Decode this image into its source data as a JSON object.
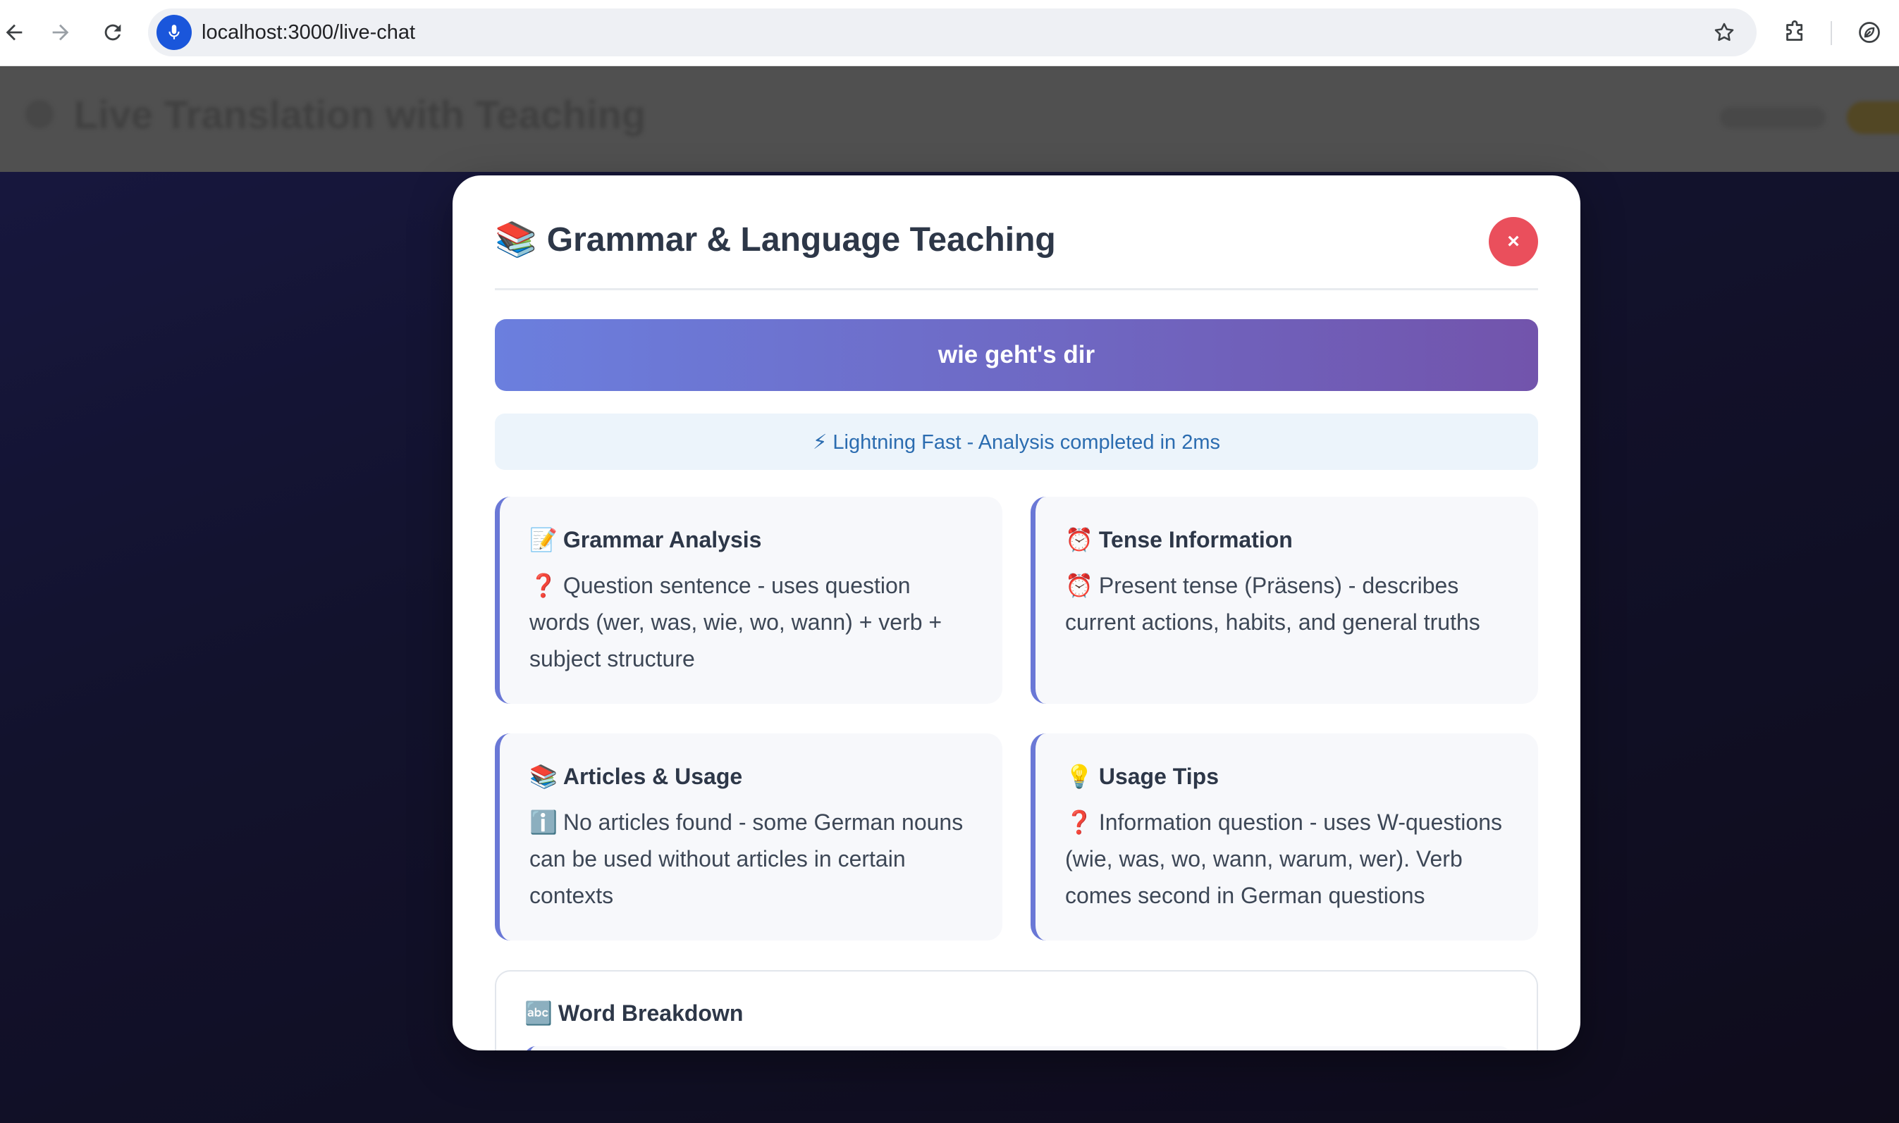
{
  "browser": {
    "url": "localhost:3000/live-chat"
  },
  "page": {
    "title": "Live Translation with Teaching"
  },
  "modal": {
    "title_emoji": "📚",
    "title": "Grammar & Language Teaching",
    "close_label": "×",
    "phrase": "wie geht's dir",
    "performance": "⚡ Lightning Fast - Analysis completed in 2ms",
    "cards": [
      {
        "title_emoji": "📝",
        "title": "Grammar Analysis",
        "body_emoji": "❓",
        "body": "Question sentence - uses question words (wer, was, wie, wo, wann) + verb + subject structure"
      },
      {
        "title_emoji": "⏰",
        "title": "Tense Information",
        "body_emoji": "⏰",
        "body": "Present tense (Präsens) - describes current actions, habits, and general truths"
      },
      {
        "title_emoji": "📚",
        "title": "Articles & Usage",
        "body_emoji": "ℹ️",
        "body": "No articles found - some German nouns can be used without articles in certain contexts"
      },
      {
        "title_emoji": "💡",
        "title": "Usage Tips",
        "body_emoji": "❓",
        "body": "Information question - uses W-questions (wie, was, wo, wann, warum, wer). Verb comes second in German questions"
      }
    ],
    "word_breakdown": {
      "title_emoji": "🔤",
      "title": "Word Breakdown"
    }
  },
  "colors": {
    "accent_gradient_start": "#6b7fde",
    "accent_gradient_end": "#7254ac",
    "card_border": "#6a78d6",
    "close_button": "#ea4f5c",
    "performance_text": "#2b6cb0"
  },
  "icons": {
    "back": "arrow-left-icon",
    "forward": "arrow-right-icon",
    "reload": "reload-icon",
    "mic": "microphone-icon",
    "bookmark": "star-icon",
    "extensions": "puzzle-icon",
    "profile": "leaf-icon"
  }
}
